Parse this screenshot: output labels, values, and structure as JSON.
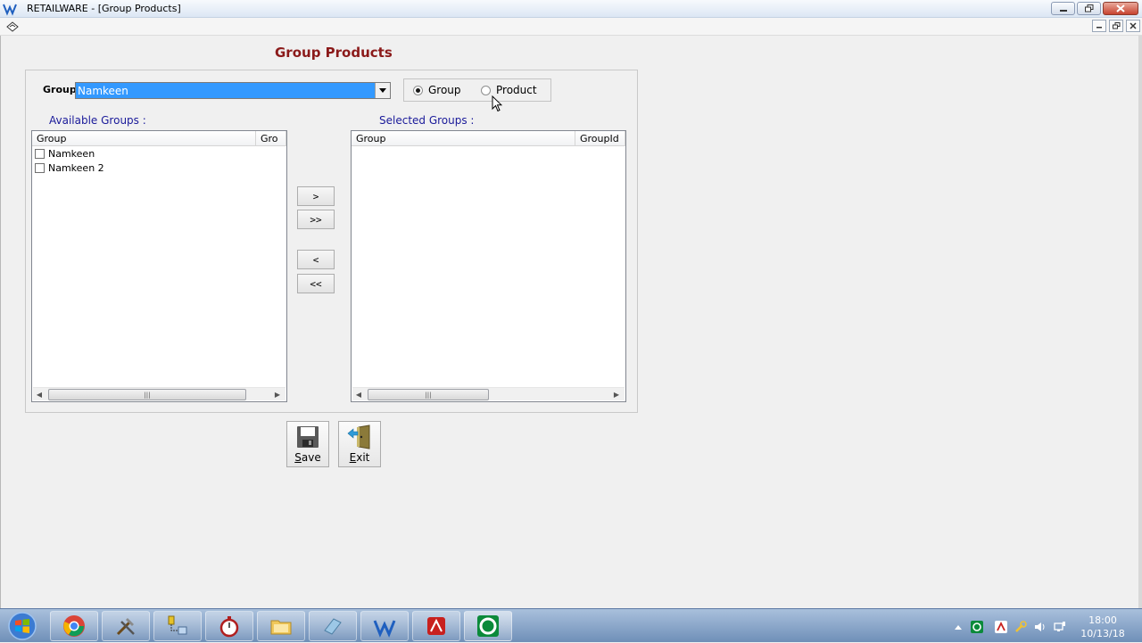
{
  "window": {
    "title": "RETAILWARE - [Group Products]"
  },
  "form": {
    "title": "Group Products",
    "group_label": "Group",
    "group_selected": "Namkeen",
    "radio_options": [
      {
        "label": "Group",
        "selected": true
      },
      {
        "label": "Product",
        "selected": false
      }
    ]
  },
  "available": {
    "caption": "Available Groups :",
    "columns": [
      "Group",
      "Gro"
    ],
    "rows": [
      {
        "label": "Namkeen",
        "checked": false
      },
      {
        "label": "Namkeen 2",
        "checked": false
      }
    ]
  },
  "selected": {
    "caption": "Selected Groups :",
    "columns": [
      "Group",
      "GroupId"
    ]
  },
  "move_buttons": {
    "add_one": ">",
    "add_all": ">>",
    "remove_one": "<",
    "remove_all": "<<"
  },
  "actions": {
    "save_rest": "ave",
    "save_mnemonic": "S",
    "exit_rest": "xit",
    "exit_mnemonic": "E"
  },
  "taskbar": {
    "apps": [
      "chrome-icon",
      "tools-icon",
      "network-icon",
      "stopwatch-icon",
      "folder-icon",
      "eraser-icon",
      "retailware-icon",
      "acrobat-icon",
      "camtasia-icon"
    ],
    "clock_time": "18:00",
    "clock_date": "10/13/18"
  },
  "colors": {
    "title_accent": "#8b1a1a",
    "combo_highlight": "#3399ff",
    "caption_blue": "#1a1a9a"
  }
}
